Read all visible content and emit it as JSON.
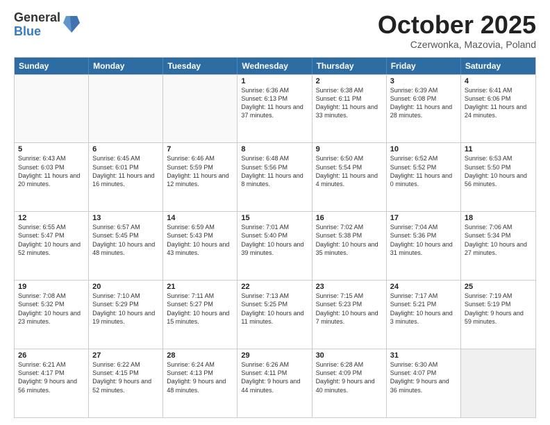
{
  "logo": {
    "general": "General",
    "blue": "Blue"
  },
  "title": "October 2025",
  "subtitle": "Czerwonka, Mazovia, Poland",
  "header_days": [
    "Sunday",
    "Monday",
    "Tuesday",
    "Wednesday",
    "Thursday",
    "Friday",
    "Saturday"
  ],
  "weeks": [
    [
      {
        "day": "",
        "sunrise": "",
        "sunset": "",
        "daylight": ""
      },
      {
        "day": "",
        "sunrise": "",
        "sunset": "",
        "daylight": ""
      },
      {
        "day": "",
        "sunrise": "",
        "sunset": "",
        "daylight": ""
      },
      {
        "day": "1",
        "sunrise": "Sunrise: 6:36 AM",
        "sunset": "Sunset: 6:13 PM",
        "daylight": "Daylight: 11 hours and 37 minutes."
      },
      {
        "day": "2",
        "sunrise": "Sunrise: 6:38 AM",
        "sunset": "Sunset: 6:11 PM",
        "daylight": "Daylight: 11 hours and 33 minutes."
      },
      {
        "day": "3",
        "sunrise": "Sunrise: 6:39 AM",
        "sunset": "Sunset: 6:08 PM",
        "daylight": "Daylight: 11 hours and 28 minutes."
      },
      {
        "day": "4",
        "sunrise": "Sunrise: 6:41 AM",
        "sunset": "Sunset: 6:06 PM",
        "daylight": "Daylight: 11 hours and 24 minutes."
      }
    ],
    [
      {
        "day": "5",
        "sunrise": "Sunrise: 6:43 AM",
        "sunset": "Sunset: 6:03 PM",
        "daylight": "Daylight: 11 hours and 20 minutes."
      },
      {
        "day": "6",
        "sunrise": "Sunrise: 6:45 AM",
        "sunset": "Sunset: 6:01 PM",
        "daylight": "Daylight: 11 hours and 16 minutes."
      },
      {
        "day": "7",
        "sunrise": "Sunrise: 6:46 AM",
        "sunset": "Sunset: 5:59 PM",
        "daylight": "Daylight: 11 hours and 12 minutes."
      },
      {
        "day": "8",
        "sunrise": "Sunrise: 6:48 AM",
        "sunset": "Sunset: 5:56 PM",
        "daylight": "Daylight: 11 hours and 8 minutes."
      },
      {
        "day": "9",
        "sunrise": "Sunrise: 6:50 AM",
        "sunset": "Sunset: 5:54 PM",
        "daylight": "Daylight: 11 hours and 4 minutes."
      },
      {
        "day": "10",
        "sunrise": "Sunrise: 6:52 AM",
        "sunset": "Sunset: 5:52 PM",
        "daylight": "Daylight: 11 hours and 0 minutes."
      },
      {
        "day": "11",
        "sunrise": "Sunrise: 6:53 AM",
        "sunset": "Sunset: 5:50 PM",
        "daylight": "Daylight: 10 hours and 56 minutes."
      }
    ],
    [
      {
        "day": "12",
        "sunrise": "Sunrise: 6:55 AM",
        "sunset": "Sunset: 5:47 PM",
        "daylight": "Daylight: 10 hours and 52 minutes."
      },
      {
        "day": "13",
        "sunrise": "Sunrise: 6:57 AM",
        "sunset": "Sunset: 5:45 PM",
        "daylight": "Daylight: 10 hours and 48 minutes."
      },
      {
        "day": "14",
        "sunrise": "Sunrise: 6:59 AM",
        "sunset": "Sunset: 5:43 PM",
        "daylight": "Daylight: 10 hours and 43 minutes."
      },
      {
        "day": "15",
        "sunrise": "Sunrise: 7:01 AM",
        "sunset": "Sunset: 5:40 PM",
        "daylight": "Daylight: 10 hours and 39 minutes."
      },
      {
        "day": "16",
        "sunrise": "Sunrise: 7:02 AM",
        "sunset": "Sunset: 5:38 PM",
        "daylight": "Daylight: 10 hours and 35 minutes."
      },
      {
        "day": "17",
        "sunrise": "Sunrise: 7:04 AM",
        "sunset": "Sunset: 5:36 PM",
        "daylight": "Daylight: 10 hours and 31 minutes."
      },
      {
        "day": "18",
        "sunrise": "Sunrise: 7:06 AM",
        "sunset": "Sunset: 5:34 PM",
        "daylight": "Daylight: 10 hours and 27 minutes."
      }
    ],
    [
      {
        "day": "19",
        "sunrise": "Sunrise: 7:08 AM",
        "sunset": "Sunset: 5:32 PM",
        "daylight": "Daylight: 10 hours and 23 minutes."
      },
      {
        "day": "20",
        "sunrise": "Sunrise: 7:10 AM",
        "sunset": "Sunset: 5:29 PM",
        "daylight": "Daylight: 10 hours and 19 minutes."
      },
      {
        "day": "21",
        "sunrise": "Sunrise: 7:11 AM",
        "sunset": "Sunset: 5:27 PM",
        "daylight": "Daylight: 10 hours and 15 minutes."
      },
      {
        "day": "22",
        "sunrise": "Sunrise: 7:13 AM",
        "sunset": "Sunset: 5:25 PM",
        "daylight": "Daylight: 10 hours and 11 minutes."
      },
      {
        "day": "23",
        "sunrise": "Sunrise: 7:15 AM",
        "sunset": "Sunset: 5:23 PM",
        "daylight": "Daylight: 10 hours and 7 minutes."
      },
      {
        "day": "24",
        "sunrise": "Sunrise: 7:17 AM",
        "sunset": "Sunset: 5:21 PM",
        "daylight": "Daylight: 10 hours and 3 minutes."
      },
      {
        "day": "25",
        "sunrise": "Sunrise: 7:19 AM",
        "sunset": "Sunset: 5:19 PM",
        "daylight": "Daylight: 9 hours and 59 minutes."
      }
    ],
    [
      {
        "day": "26",
        "sunrise": "Sunrise: 6:21 AM",
        "sunset": "Sunset: 4:17 PM",
        "daylight": "Daylight: 9 hours and 56 minutes."
      },
      {
        "day": "27",
        "sunrise": "Sunrise: 6:22 AM",
        "sunset": "Sunset: 4:15 PM",
        "daylight": "Daylight: 9 hours and 52 minutes."
      },
      {
        "day": "28",
        "sunrise": "Sunrise: 6:24 AM",
        "sunset": "Sunset: 4:13 PM",
        "daylight": "Daylight: 9 hours and 48 minutes."
      },
      {
        "day": "29",
        "sunrise": "Sunrise: 6:26 AM",
        "sunset": "Sunset: 4:11 PM",
        "daylight": "Daylight: 9 hours and 44 minutes."
      },
      {
        "day": "30",
        "sunrise": "Sunrise: 6:28 AM",
        "sunset": "Sunset: 4:09 PM",
        "daylight": "Daylight: 9 hours and 40 minutes."
      },
      {
        "day": "31",
        "sunrise": "Sunrise: 6:30 AM",
        "sunset": "Sunset: 4:07 PM",
        "daylight": "Daylight: 9 hours and 36 minutes."
      },
      {
        "day": "",
        "sunrise": "",
        "sunset": "",
        "daylight": ""
      }
    ]
  ]
}
